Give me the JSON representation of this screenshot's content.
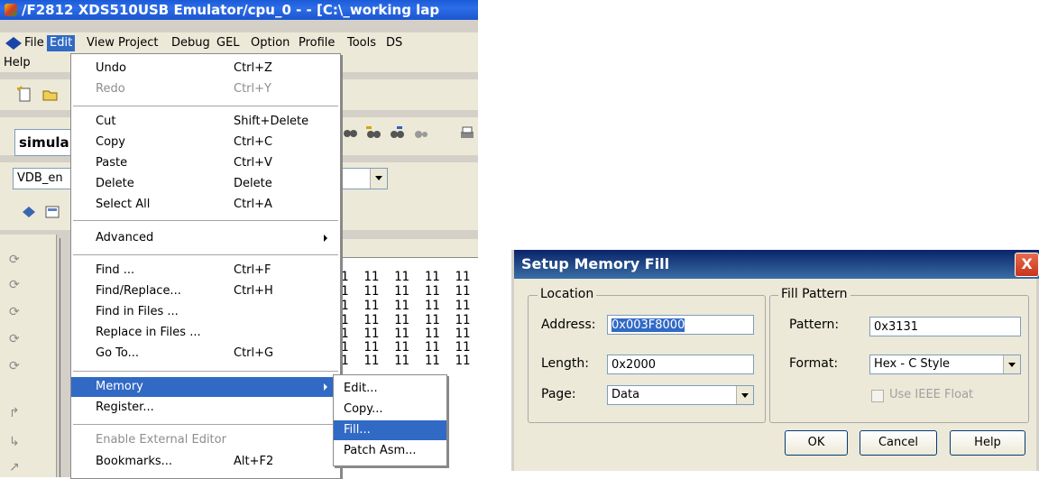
{
  "ide": {
    "title": "/F2812 XDS510USB Emulator/cpu_0 - - [C:\\_working lap",
    "menubar": [
      "File",
      "Edit",
      "View",
      "Project",
      "Debug",
      "GEL",
      "Option",
      "Profile",
      "Tools",
      "DS"
    ],
    "menubar_help": "Help",
    "toolbar_combo_left": "simula",
    "toolbar_combo2": "VDB_en",
    "memory_rows": [
      "1  11  11  11  11",
      "1  11  11  11  11",
      "1  11  11  11  11",
      "1  11  11  11  11",
      "1  11  11  11  11",
      "1  11  11  11  11",
      "1  11  11  11  11"
    ]
  },
  "edit_menu": {
    "items": [
      {
        "label": "Undo",
        "shortcut": "Ctrl+Z",
        "disabled": false
      },
      {
        "label": "Redo",
        "shortcut": "Ctrl+Y",
        "disabled": true
      },
      {
        "label": "Cut",
        "shortcut": "Shift+Delete",
        "disabled": false
      },
      {
        "label": "Copy",
        "shortcut": "Ctrl+C",
        "disabled": false
      },
      {
        "label": "Paste",
        "shortcut": "Ctrl+V",
        "disabled": false
      },
      {
        "label": "Delete",
        "shortcut": "Delete",
        "disabled": false
      },
      {
        "label": "Select All",
        "shortcut": "Ctrl+A",
        "disabled": false
      },
      {
        "label": "Advanced",
        "shortcut": "",
        "disabled": false
      },
      {
        "label": "Find ...",
        "shortcut": "Ctrl+F",
        "disabled": false
      },
      {
        "label": "Find/Replace...",
        "shortcut": "Ctrl+H",
        "disabled": false
      },
      {
        "label": "Find in Files ...",
        "shortcut": "",
        "disabled": false
      },
      {
        "label": "Replace in Files ...",
        "shortcut": "",
        "disabled": false
      },
      {
        "label": "Go To...",
        "shortcut": "Ctrl+G",
        "disabled": false
      },
      {
        "label": "Memory",
        "shortcut": "",
        "disabled": false
      },
      {
        "label": "Register...",
        "shortcut": "",
        "disabled": false
      },
      {
        "label": "Enable External Editor",
        "shortcut": "",
        "disabled": true
      },
      {
        "label": "Bookmarks...",
        "shortcut": "Alt+F2",
        "disabled": false
      }
    ]
  },
  "memory_submenu": {
    "items": [
      "Edit...",
      "Copy...",
      "Fill...",
      "Patch Asm..."
    ]
  },
  "dialog": {
    "title": "Setup Memory Fill",
    "close": "X",
    "location_group": "Location",
    "address_label": "Address:",
    "address_value": "0x003F8000",
    "length_label": "Length:",
    "length_value": "0x2000",
    "page_label": "Page:",
    "page_value": "Data",
    "fill_group": "Fill Pattern",
    "pattern_label": "Pattern:",
    "pattern_value": "0x3131",
    "format_label": "Format:",
    "format_value": "Hex - C Style",
    "ieee_label": "Use IEEE Float",
    "ok": "OK",
    "cancel": "Cancel",
    "help": "Help"
  },
  "colors": {
    "menu_highlight": "#316ac5",
    "title_bar": "#2c6de8",
    "dialog_title": "#0a246a"
  }
}
